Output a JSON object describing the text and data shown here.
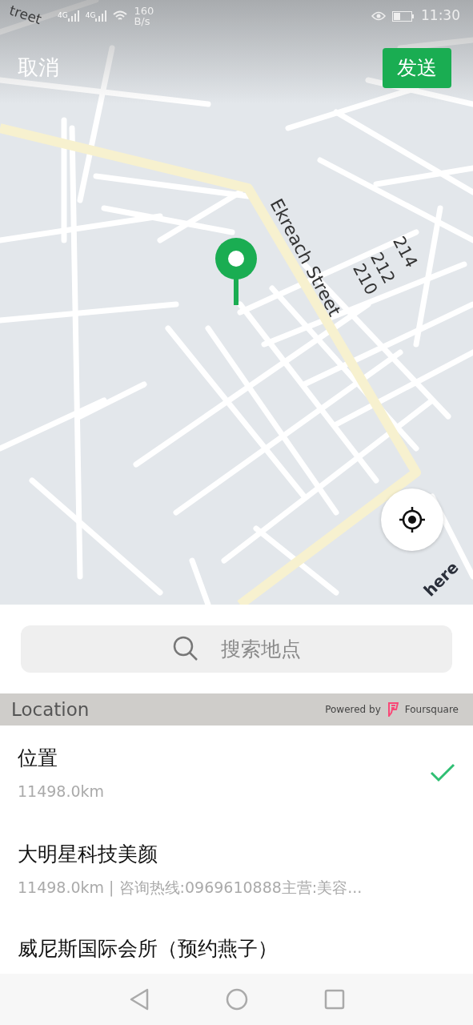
{
  "status_bar": {
    "signals": [
      "4G",
      "4G"
    ],
    "speed": "160",
    "speed_unit": "B/s",
    "time": "11:30"
  },
  "header": {
    "cancel": "取消",
    "send": "发送"
  },
  "map": {
    "labels": [
      {
        "kind": "street",
        "text": "treet"
      },
      {
        "kind": "street",
        "text": "Ekreach Street"
      },
      {
        "kind": "number",
        "text": "214"
      },
      {
        "kind": "number",
        "text": "212"
      },
      {
        "kind": "number",
        "text": "210"
      }
    ],
    "attribution": "here"
  },
  "search": {
    "placeholder": "搜索地点"
  },
  "section": {
    "title": "Location",
    "powered_by": "Powered by",
    "provider": "Foursquare"
  },
  "places": [
    {
      "name": "位置",
      "detail": "11498.0km",
      "selected": true
    },
    {
      "name": "大明星科技美颜",
      "detail": "11498.0km | 咨询热线:0969610888主营:美容...",
      "selected": false
    },
    {
      "name": "威尼斯国际会所（预约燕子）",
      "selected": false
    }
  ]
}
